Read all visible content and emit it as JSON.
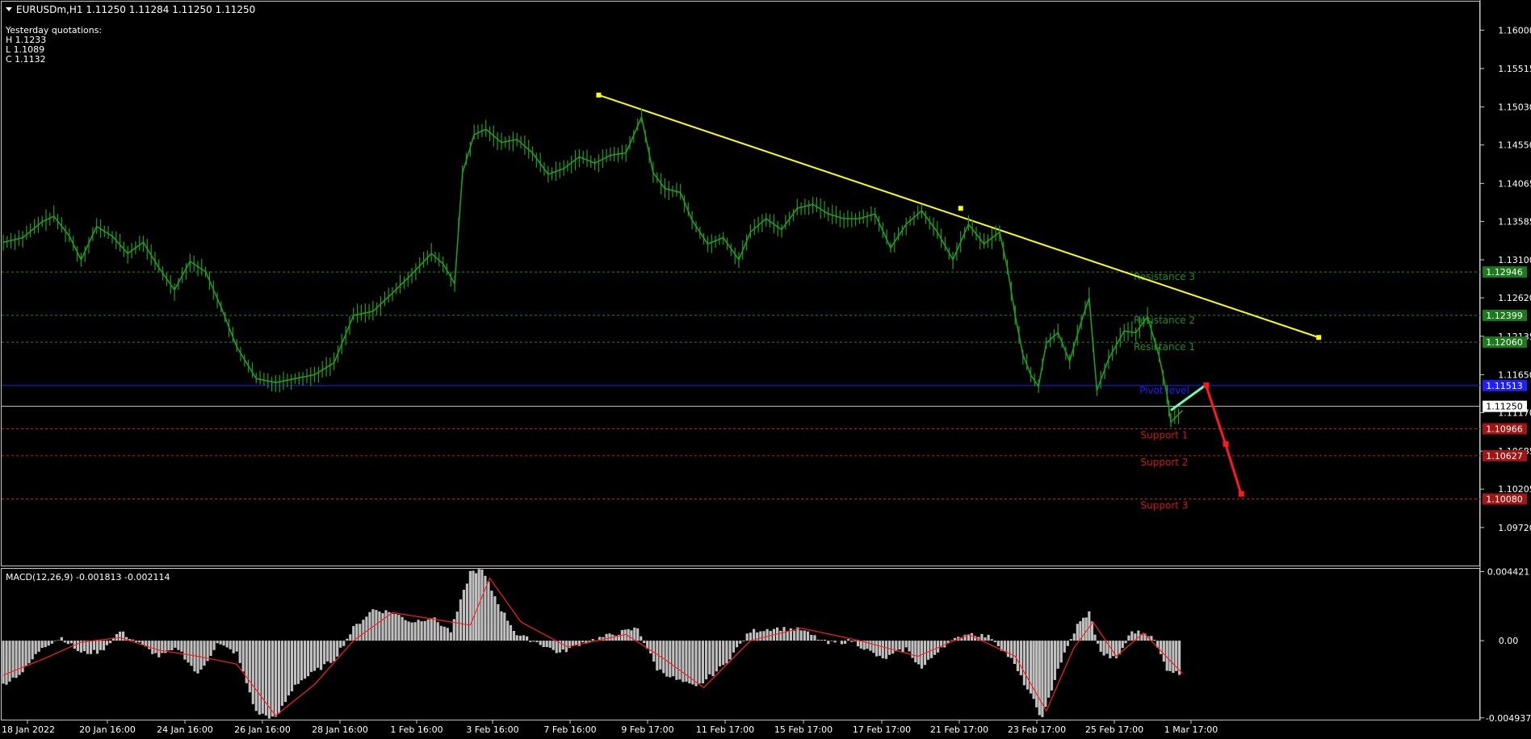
{
  "header": {
    "menu_icon": "triangle-down-icon",
    "symbol_line": "EURUSDm,H1  1.11250 1.11284 1.11250 1.11250",
    "yesterday_title": "Yesterday quotations:",
    "yesterday_h": "H 1.1233",
    "yesterday_l": "L 1.1089",
    "yesterday_c": "C 1.1132"
  },
  "colors": {
    "background": "#000000",
    "candles": "#1f9d1f",
    "trendline": "#ffff00",
    "resistance": "#1e8c1e",
    "support": "#cc1b1b",
    "pivot": "#1f1fff",
    "current_price": "#c8c8c8",
    "forecast_up": "#66ffb3",
    "forecast_down": "#ff1a1a",
    "macd_hist": "#c0c0c0",
    "macd_signal": "#ff2020"
  },
  "chart_data": [
    {
      "type": "line",
      "title": "EURUSDm,H1",
      "ylim": [
        1.0925,
        1.1636
      ],
      "yticks": [
        "1.16000",
        "1.15515",
        "1.15030",
        "1.14550",
        "1.14065",
        "1.13585",
        "1.13100",
        "1.12620",
        "1.12135",
        "1.11650",
        "1.11170",
        "1.10685",
        "1.10205",
        "1.09720"
      ],
      "xlabels": [
        "18 Jan 2022",
        "20 Jan 16:00",
        "24 Jan 16:00",
        "26 Jan 16:00",
        "28 Jan 16:00",
        "1 Feb 16:00",
        "3 Feb 16:00",
        "7 Feb 16:00",
        "9 Feb 17:00",
        "11 Feb 17:00",
        "15 Feb 17:00",
        "17 Feb 17:00",
        "21 Feb 17:00",
        "23 Feb 17:00",
        "25 Feb 17:00",
        "1 Mar 17:00"
      ],
      "price_series": [
        {
          "x": 0,
          "y": 1.1332
        },
        {
          "x": 0.5,
          "y": 1.1338
        },
        {
          "x": 1.0,
          "y": 1.1358
        },
        {
          "x": 1.3,
          "y": 1.1365
        },
        {
          "x": 1.7,
          "y": 1.134
        },
        {
          "x": 2.0,
          "y": 1.131
        },
        {
          "x": 2.4,
          "y": 1.1352
        },
        {
          "x": 2.8,
          "y": 1.134
        },
        {
          "x": 3.2,
          "y": 1.1318
        },
        {
          "x": 3.6,
          "y": 1.1332
        },
        {
          "x": 4.0,
          "y": 1.13
        },
        {
          "x": 4.4,
          "y": 1.1272
        },
        {
          "x": 4.8,
          "y": 1.1308
        },
        {
          "x": 5.2,
          "y": 1.1295
        },
        {
          "x": 5.6,
          "y": 1.125
        },
        {
          "x": 6.0,
          "y": 1.12
        },
        {
          "x": 6.5,
          "y": 1.116
        },
        {
          "x": 7.0,
          "y": 1.1155
        },
        {
          "x": 7.5,
          "y": 1.116
        },
        {
          "x": 8.0,
          "y": 1.1165
        },
        {
          "x": 8.5,
          "y": 1.118
        },
        {
          "x": 9.0,
          "y": 1.124
        },
        {
          "x": 9.5,
          "y": 1.1245
        },
        {
          "x": 10.0,
          "y": 1.1268
        },
        {
          "x": 10.5,
          "y": 1.1292
        },
        {
          "x": 11.0,
          "y": 1.1318
        },
        {
          "x": 11.3,
          "y": 1.1305
        },
        {
          "x": 11.6,
          "y": 1.128
        },
        {
          "x": 11.8,
          "y": 1.142
        },
        {
          "x": 12.1,
          "y": 1.1468
        },
        {
          "x": 12.4,
          "y": 1.1475
        },
        {
          "x": 12.8,
          "y": 1.1458
        },
        {
          "x": 13.2,
          "y": 1.1462
        },
        {
          "x": 13.6,
          "y": 1.1445
        },
        {
          "x": 14.0,
          "y": 1.1418
        },
        {
          "x": 14.4,
          "y": 1.1425
        },
        {
          "x": 14.8,
          "y": 1.144
        },
        {
          "x": 15.2,
          "y": 1.1432
        },
        {
          "x": 15.6,
          "y": 1.1442
        },
        {
          "x": 16.0,
          "y": 1.1445
        },
        {
          "x": 16.4,
          "y": 1.149
        },
        {
          "x": 16.7,
          "y": 1.142
        },
        {
          "x": 17.0,
          "y": 1.14
        },
        {
          "x": 17.4,
          "y": 1.1395
        },
        {
          "x": 17.7,
          "y": 1.136
        },
        {
          "x": 18.1,
          "y": 1.133
        },
        {
          "x": 18.5,
          "y": 1.1338
        },
        {
          "x": 18.9,
          "y": 1.131
        },
        {
          "x": 19.2,
          "y": 1.1345
        },
        {
          "x": 19.6,
          "y": 1.1362
        },
        {
          "x": 20.0,
          "y": 1.1348
        },
        {
          "x": 20.4,
          "y": 1.1375
        },
        {
          "x": 20.8,
          "y": 1.138
        },
        {
          "x": 21.2,
          "y": 1.1368
        },
        {
          "x": 21.6,
          "y": 1.1362
        },
        {
          "x": 22.0,
          "y": 1.1362
        },
        {
          "x": 22.4,
          "y": 1.1368
        },
        {
          "x": 22.8,
          "y": 1.1325
        },
        {
          "x": 23.2,
          "y": 1.1355
        },
        {
          "x": 23.6,
          "y": 1.1372
        },
        {
          "x": 24.0,
          "y": 1.1345
        },
        {
          "x": 24.4,
          "y": 1.131
        },
        {
          "x": 24.8,
          "y": 1.1355
        },
        {
          "x": 25.2,
          "y": 1.133
        },
        {
          "x": 25.6,
          "y": 1.1345
        },
        {
          "x": 25.8,
          "y": 1.13
        },
        {
          "x": 26.0,
          "y": 1.124
        },
        {
          "x": 26.2,
          "y": 1.119
        },
        {
          "x": 26.4,
          "y": 1.1165
        },
        {
          "x": 26.6,
          "y": 1.115
        },
        {
          "x": 26.8,
          "y": 1.1205
        },
        {
          "x": 27.1,
          "y": 1.1218
        },
        {
          "x": 27.4,
          "y": 1.1182
        },
        {
          "x": 27.7,
          "y": 1.1232
        },
        {
          "x": 27.9,
          "y": 1.1262
        },
        {
          "x": 28.1,
          "y": 1.1145
        },
        {
          "x": 28.4,
          "y": 1.1185
        },
        {
          "x": 28.8,
          "y": 1.122
        },
        {
          "x": 29.1,
          "y": 1.1218
        },
        {
          "x": 29.4,
          "y": 1.1238
        },
        {
          "x": 29.7,
          "y": 1.1188
        },
        {
          "x": 29.9,
          "y": 1.114
        },
        {
          "x": 30.0,
          "y": 1.1105
        },
        {
          "x": 30.3,
          "y": 1.112
        }
      ],
      "trendline": {
        "start": {
          "x": 15.3,
          "y": 1.1518
        },
        "mid": {
          "x": 24.6,
          "y": 1.1375
        },
        "end": {
          "x": 33.8,
          "y": 1.1212
        }
      },
      "levels": [
        {
          "label": "Resistance 3",
          "value": "1.12946",
          "kind": "resistance"
        },
        {
          "label": "Resistance 2",
          "value": "1.12399",
          "kind": "resistance"
        },
        {
          "label": "Resistance 1",
          "value": "1.12060",
          "kind": "resistance"
        },
        {
          "label": "Pivot level",
          "value": "1.11513",
          "kind": "pivot"
        },
        {
          "label": "",
          "value": "1.11250",
          "kind": "current"
        },
        {
          "label": "Support 1",
          "value": "1.10966",
          "kind": "support"
        },
        {
          "label": "Support 2",
          "value": "1.10627",
          "kind": "support"
        },
        {
          "label": "Support 3",
          "value": "1.10080",
          "kind": "support"
        }
      ],
      "forecast": {
        "up": [
          {
            "x": 30.0,
            "y": 1.112
          },
          {
            "x": 30.9,
            "y": 1.1152
          }
        ],
        "down": [
          {
            "x": 30.9,
            "y": 1.1152
          },
          {
            "x": 31.4,
            "y": 1.1078
          },
          {
            "x": 31.8,
            "y": 1.1015
          }
        ]
      }
    },
    {
      "type": "bar",
      "title": "MACD(12,26,9) -0.001813 -0.002114",
      "ylim": [
        -0.005,
        0.00455
      ],
      "yticks": [
        "0.004421",
        "0.00",
        "-0.004937"
      ],
      "histogram": [
        {
          "x": 0,
          "y": -0.0028
        },
        {
          "x": 0.5,
          "y": -0.002
        },
        {
          "x": 1.0,
          "y": -0.0004
        },
        {
          "x": 1.5,
          "y": 0.0002
        },
        {
          "x": 2.0,
          "y": -0.0008
        },
        {
          "x": 2.5,
          "y": -0.0007
        },
        {
          "x": 3.0,
          "y": 0.0006
        },
        {
          "x": 3.5,
          "y": -0.0002
        },
        {
          "x": 4.0,
          "y": -0.001
        },
        {
          "x": 4.5,
          "y": -0.0005
        },
        {
          "x": 5.0,
          "y": -0.0022
        },
        {
          "x": 5.5,
          "y": -0.0002
        },
        {
          "x": 6.0,
          "y": -0.0008
        },
        {
          "x": 6.5,
          "y": -0.0046
        },
        {
          "x": 7.0,
          "y": -0.005
        },
        {
          "x": 7.5,
          "y": -0.0028
        },
        {
          "x": 8.0,
          "y": -0.002
        },
        {
          "x": 8.5,
          "y": -0.0012
        },
        {
          "x": 9.0,
          "y": 0.0008
        },
        {
          "x": 9.5,
          "y": 0.002
        },
        {
          "x": 10.0,
          "y": 0.0018
        },
        {
          "x": 10.5,
          "y": 0.0012
        },
        {
          "x": 11.0,
          "y": 0.0015
        },
        {
          "x": 11.5,
          "y": 0.0006
        },
        {
          "x": 12.0,
          "y": 0.0044
        },
        {
          "x": 12.3,
          "y": 0.0045
        },
        {
          "x": 12.8,
          "y": 0.002
        },
        {
          "x": 13.2,
          "y": 0.0004
        },
        {
          "x": 13.8,
          "y": -0.0002
        },
        {
          "x": 14.3,
          "y": -0.0008
        },
        {
          "x": 14.8,
          "y": -0.0002
        },
        {
          "x": 15.5,
          "y": 0.0003
        },
        {
          "x": 16.3,
          "y": 0.0008
        },
        {
          "x": 16.8,
          "y": -0.0018
        },
        {
          "x": 17.3,
          "y": -0.0025
        },
        {
          "x": 17.8,
          "y": -0.003
        },
        {
          "x": 18.5,
          "y": -0.0016
        },
        {
          "x": 19.2,
          "y": 0.0006
        },
        {
          "x": 19.8,
          "y": 0.0008
        },
        {
          "x": 20.5,
          "y": 0.0007
        },
        {
          "x": 21.2,
          "y": -0.0002
        },
        {
          "x": 21.8,
          "y": 0.0
        },
        {
          "x": 22.6,
          "y": -0.0012
        },
        {
          "x": 23.2,
          "y": -0.0005
        },
        {
          "x": 23.6,
          "y": -0.0018
        },
        {
          "x": 24.1,
          "y": -0.0004
        },
        {
          "x": 24.8,
          "y": 0.0005
        },
        {
          "x": 25.4,
          "y": 0.0002
        },
        {
          "x": 25.9,
          "y": -0.0012
        },
        {
          "x": 26.4,
          "y": -0.0035
        },
        {
          "x": 26.7,
          "y": -0.005
        },
        {
          "x": 27.1,
          "y": -0.0018
        },
        {
          "x": 27.6,
          "y": 0.001
        },
        {
          "x": 27.9,
          "y": 0.0018
        },
        {
          "x": 28.2,
          "y": -0.0008
        },
        {
          "x": 28.6,
          "y": -0.0012
        },
        {
          "x": 29.0,
          "y": 0.0006
        },
        {
          "x": 29.5,
          "y": 0.0004
        },
        {
          "x": 29.9,
          "y": -0.0018
        },
        {
          "x": 30.3,
          "y": -0.0022
        }
      ],
      "signal": [
        {
          "x": 0,
          "y": -0.0022
        },
        {
          "x": 1.0,
          "y": -0.0012
        },
        {
          "x": 2.0,
          "y": -0.0001
        },
        {
          "x": 3.0,
          "y": 0.0002
        },
        {
          "x": 4.0,
          "y": -0.0006
        },
        {
          "x": 5.0,
          "y": -0.001
        },
        {
          "x": 6.0,
          "y": -0.0015
        },
        {
          "x": 7.0,
          "y": -0.0048
        },
        {
          "x": 8.0,
          "y": -0.0028
        },
        {
          "x": 9.0,
          "y": 0.0
        },
        {
          "x": 10.0,
          "y": 0.0018
        },
        {
          "x": 11.0,
          "y": 0.0014
        },
        {
          "x": 12.0,
          "y": 0.001
        },
        {
          "x": 12.5,
          "y": 0.004
        },
        {
          "x": 13.3,
          "y": 0.0012
        },
        {
          "x": 14.5,
          "y": -0.0004
        },
        {
          "x": 16.0,
          "y": 0.0004
        },
        {
          "x": 17.0,
          "y": -0.0012
        },
        {
          "x": 18.0,
          "y": -0.003
        },
        {
          "x": 19.2,
          "y": 0.0
        },
        {
          "x": 20.5,
          "y": 0.0008
        },
        {
          "x": 22.0,
          "y": 0.0
        },
        {
          "x": 23.5,
          "y": -0.001
        },
        {
          "x": 24.8,
          "y": 0.0004
        },
        {
          "x": 26.0,
          "y": -0.001
        },
        {
          "x": 26.8,
          "y": -0.0045
        },
        {
          "x": 27.5,
          "y": -0.0005
        },
        {
          "x": 28.0,
          "y": 0.0012
        },
        {
          "x": 28.6,
          "y": -0.001
        },
        {
          "x": 29.3,
          "y": 0.0005
        },
        {
          "x": 30.3,
          "y": -0.0021
        }
      ]
    }
  ]
}
